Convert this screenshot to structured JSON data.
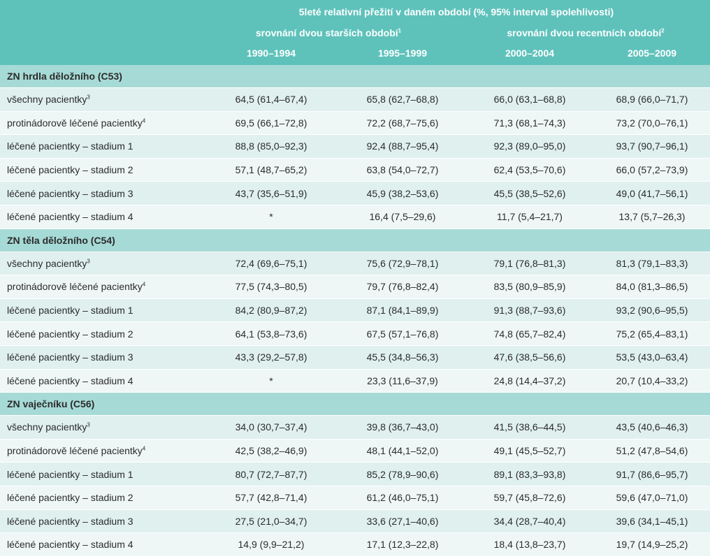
{
  "header": {
    "title": "5leté relativní přežití v daném období (%, 95% interval spolehlivosti)",
    "group1": "srovnání dvou starších období",
    "group1_sup": "1",
    "group2": "srovnání dvou recentních období",
    "group2_sup": "2",
    "columns": [
      "1990–1994",
      "1995–1999",
      "2000–2004",
      "2005–2009"
    ]
  },
  "sections": [
    {
      "title": "ZN hrdla děložního (C53)",
      "rows": [
        {
          "label": "všechny pacientky",
          "sup": "3",
          "values": [
            "64,5 (61,4–67,4)",
            "65,8 (62,7–68,8)",
            "66,0 (63,1–68,8)",
            "68,9 (66,0–71,7)"
          ]
        },
        {
          "label": "protinádorově léčené pacientky",
          "sup": "4",
          "values": [
            "69,5 (66,1–72,8)",
            "72,2 (68,7–75,6)",
            "71,3 (68,1–74,3)",
            "73,2 (70,0–76,1)"
          ]
        },
        {
          "label": "léčené pacientky – stadium 1",
          "sup": "",
          "values": [
            "88,8 (85,0–92,3)",
            "92,4 (88,7–95,4)",
            "92,3 (89,0–95,0)",
            "93,7 (90,7–96,1)"
          ]
        },
        {
          "label": "léčené pacientky – stadium 2",
          "sup": "",
          "values": [
            "57,1 (48,7–65,2)",
            "63,8 (54,0–72,7)",
            "62,4 (53,5–70,6)",
            "66,0 (57,2–73,9)"
          ]
        },
        {
          "label": "léčené pacientky – stadium 3",
          "sup": "",
          "values": [
            "43,7 (35,6–51,9)",
            "45,9 (38,2–53,6)",
            "45,5 (38,5–52,6)",
            "49,0 (41,7–56,1)"
          ]
        },
        {
          "label": "léčené pacientky – stadium 4",
          "sup": "",
          "values": [
            "*",
            "16,4 (7,5–29,6)",
            "11,7 (5,4–21,7)",
            "13,7 (5,7–26,3)"
          ]
        }
      ]
    },
    {
      "title": "ZN těla děložního (C54)",
      "rows": [
        {
          "label": "všechny pacientky",
          "sup": "3",
          "values": [
            "72,4 (69,6–75,1)",
            "75,6 (72,9–78,1)",
            "79,1 (76,8–81,3)",
            "81,3 (79,1–83,3)"
          ]
        },
        {
          "label": "protinádorově léčené pacientky",
          "sup": "4",
          "values": [
            "77,5 (74,3–80,5)",
            "79,7 (76,8–82,4)",
            "83,5 (80,9–85,9)",
            "84,0 (81,3–86,5)"
          ]
        },
        {
          "label": "léčené pacientky – stadium 1",
          "sup": "",
          "values": [
            "84,2 (80,9–87,2)",
            "87,1 (84,1–89,9)",
            "91,3 (88,7–93,6)",
            "93,2 (90,6–95,5)"
          ]
        },
        {
          "label": "léčené pacientky – stadium 2",
          "sup": "",
          "values": [
            "64,1 (53,8–73,6)",
            "67,5 (57,1–76,8)",
            "74,8 (65,7–82,4)",
            "75,2 (65,4–83,1)"
          ]
        },
        {
          "label": "léčené pacientky – stadium 3",
          "sup": "",
          "values": [
            "43,3 (29,2–57,8)",
            "45,5 (34,8–56,3)",
            "47,6 (38,5–56,6)",
            "53,5 (43,0–63,4)"
          ]
        },
        {
          "label": "léčené pacientky – stadium 4",
          "sup": "",
          "values": [
            "*",
            "23,3 (11,6–37,9)",
            "24,8 (14,4–37,2)",
            "20,7 (10,4–33,2)"
          ]
        }
      ]
    },
    {
      "title": "ZN vaječníku (C56)",
      "rows": [
        {
          "label": "všechny pacientky",
          "sup": "3",
          "values": [
            "34,0 (30,7–37,4)",
            "39,8 (36,7–43,0)",
            "41,5 (38,6–44,5)",
            "43,5 (40,6–46,3)"
          ]
        },
        {
          "label": "protinádorově léčené pacientky",
          "sup": "4",
          "values": [
            "42,5 (38,2–46,9)",
            "48,1 (44,1–52,0)",
            "49,1 (45,5–52,7)",
            "51,2 (47,8–54,6)"
          ]
        },
        {
          "label": "léčené pacientky – stadium 1",
          "sup": "",
          "values": [
            "80,7 (72,7–87,7)",
            "85,2 (78,9–90,6)",
            "89,1 (83,3–93,8)",
            "91,7 (86,6–95,7)"
          ]
        },
        {
          "label": "léčené pacientky – stadium 2",
          "sup": "",
          "values": [
            "57,7 (42,8–71,4)",
            "61,2 (46,0–75,1)",
            "59,7 (45,8–72,6)",
            "59,6 (47,0–71,0)"
          ]
        },
        {
          "label": "léčené pacientky – stadium 3",
          "sup": "",
          "values": [
            "27,5 (21,0–34,7)",
            "33,6 (27,1–40,6)",
            "34,4 (28,7–40,4)",
            "39,6 (34,1–45,1)"
          ]
        },
        {
          "label": "léčené pacientky – stadium 4",
          "sup": "",
          "values": [
            "14,9 (9,9–21,2)",
            "17,1 (12,3–22,8)",
            "18,4 (13,8–23,7)",
            "19,7 (14,9–25,2)"
          ]
        }
      ]
    }
  ]
}
